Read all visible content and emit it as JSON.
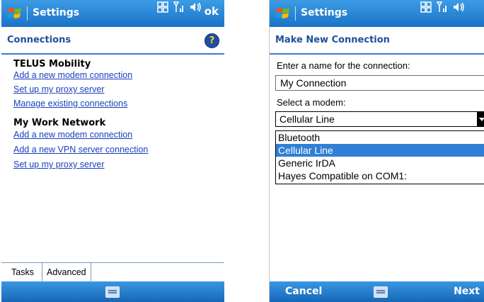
{
  "left": {
    "title": "Settings",
    "ok_label": "ok",
    "header_title": "Connections",
    "groups": [
      {
        "heading": "TELUS Mobility",
        "links": [
          "Add a new modem connection",
          "Set up my proxy server",
          "Manage existing connections"
        ]
      },
      {
        "heading": "My Work Network",
        "links": [
          "Add a new modem connection",
          "Add a new VPN server connection",
          "Set up my proxy server"
        ]
      }
    ],
    "tabs": [
      {
        "label": "Tasks",
        "selected": true
      },
      {
        "label": "Advanced",
        "selected": false
      }
    ]
  },
  "right": {
    "title": "Settings",
    "header_title": "Make New Connection",
    "name_label": "Enter a name for the connection:",
    "name_value": "My Connection",
    "modem_label": "Select a modem:",
    "modem_selected": "Cellular Line",
    "modem_options": [
      "Bluetooth",
      "Cellular Line",
      "Generic IrDA",
      "Hayes Compatible on COM1:"
    ],
    "cancel_label": "Cancel",
    "next_label": "Next"
  },
  "icons": {
    "start": "windows-flag-icon",
    "help": "help-icon",
    "connectivity": "connectivity-icon",
    "signal": "signal-strength-icon",
    "volume": "volume-icon",
    "keyboard": "keyboard-icon"
  },
  "colors": {
    "titlebar": "#1a73c7",
    "header_text": "#1c4f9c",
    "link": "#1a3fbd",
    "selection": "#2f7fd6"
  }
}
